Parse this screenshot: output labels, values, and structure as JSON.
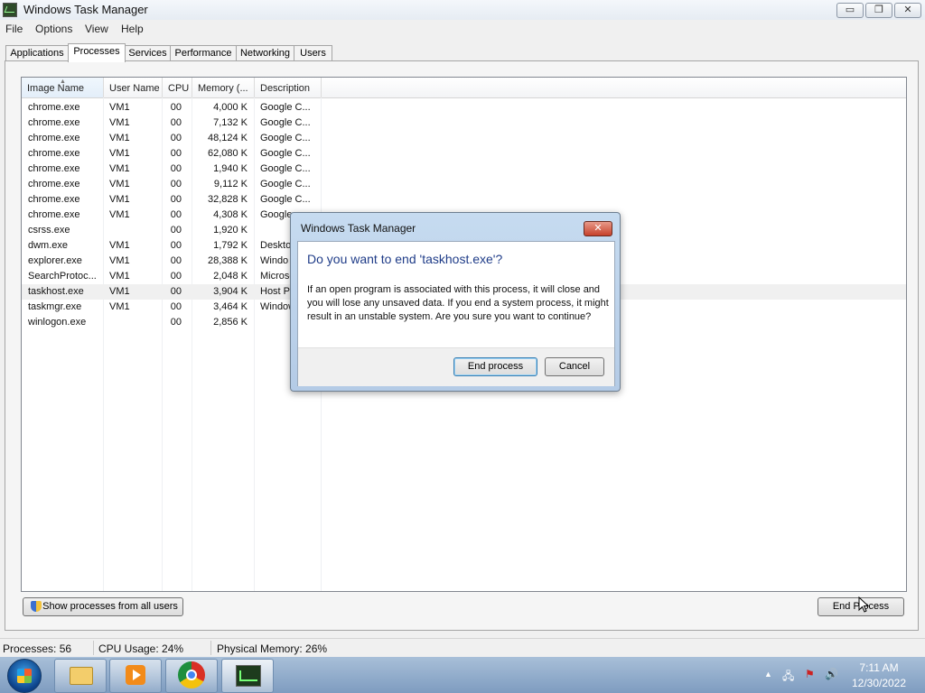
{
  "window": {
    "title": "Windows Task Manager",
    "min_glyph": "▭",
    "restore_glyph": "❐",
    "close_glyph": "✕"
  },
  "menu": [
    "File",
    "Options",
    "View",
    "Help"
  ],
  "tabs": [
    "Applications",
    "Processes",
    "Services",
    "Performance",
    "Networking",
    "Users"
  ],
  "active_tab": "Processes",
  "columns": [
    "Image Name",
    "User Name",
    "CPU",
    "Memory (...",
    "Description"
  ],
  "sorted_column": "Image Name",
  "processes": [
    {
      "name": "chrome.exe",
      "user": "VM1",
      "cpu": "00",
      "memory": "4,000 K",
      "description": "Google C..."
    },
    {
      "name": "chrome.exe",
      "user": "VM1",
      "cpu": "00",
      "memory": "7,132 K",
      "description": "Google C..."
    },
    {
      "name": "chrome.exe",
      "user": "VM1",
      "cpu": "00",
      "memory": "48,124 K",
      "description": "Google C..."
    },
    {
      "name": "chrome.exe",
      "user": "VM1",
      "cpu": "00",
      "memory": "62,080 K",
      "description": "Google C..."
    },
    {
      "name": "chrome.exe",
      "user": "VM1",
      "cpu": "00",
      "memory": "1,940 K",
      "description": "Google C..."
    },
    {
      "name": "chrome.exe",
      "user": "VM1",
      "cpu": "00",
      "memory": "9,112 K",
      "description": "Google C..."
    },
    {
      "name": "chrome.exe",
      "user": "VM1",
      "cpu": "00",
      "memory": "32,828 K",
      "description": "Google C..."
    },
    {
      "name": "chrome.exe",
      "user": "VM1",
      "cpu": "00",
      "memory": "4,308 K",
      "description": "Google"
    },
    {
      "name": "csrss.exe",
      "user": "",
      "cpu": "00",
      "memory": "1,920 K",
      "description": ""
    },
    {
      "name": "dwm.exe",
      "user": "VM1",
      "cpu": "00",
      "memory": "1,792 K",
      "description": "Deskto"
    },
    {
      "name": "explorer.exe",
      "user": "VM1",
      "cpu": "00",
      "memory": "28,388 K",
      "description": "Windo"
    },
    {
      "name": "SearchProtoc...",
      "user": "VM1",
      "cpu": "00",
      "memory": "2,048 K",
      "description": "Microso"
    },
    {
      "name": "taskhost.exe",
      "user": "VM1",
      "cpu": "00",
      "memory": "3,904 K",
      "description": "Host Pr"
    },
    {
      "name": "taskmgr.exe",
      "user": "VM1",
      "cpu": "00",
      "memory": "3,464 K",
      "description": "Window"
    },
    {
      "name": "winlogon.exe",
      "user": "",
      "cpu": "00",
      "memory": "2,856 K",
      "description": ""
    }
  ],
  "selected_process": "taskhost.exe",
  "buttons": {
    "show_all": "Show processes from all users",
    "end_process": "End Process"
  },
  "status": {
    "processes": "Processes: 56",
    "cpu": "CPU Usage: 24%",
    "memory": "Physical Memory: 26%"
  },
  "taskbar": {
    "apps": [
      "folder-icon",
      "media-player-icon",
      "chrome-icon",
      "task-manager-icon"
    ],
    "tray": {
      "arrow": "▲",
      "network": "🖧",
      "flag": "⚑",
      "volume": "🔊"
    },
    "time": "7:11 AM",
    "date": "12/30/2022"
  },
  "dialog": {
    "title": "Windows Task Manager",
    "close_glyph": "✕",
    "heading": "Do you want to end 'taskhost.exe'?",
    "message": "If an open program is associated with this process, it will close and you will lose any unsaved data. If you end a system process, it might result in an unstable system. Are you sure you want to continue?",
    "confirm_label": "End process",
    "cancel_label": "Cancel"
  },
  "colors": {
    "heading": "#1f3c88",
    "dialog_frame": "#b4cbe6",
    "taskbar": "#7e9cc0"
  }
}
